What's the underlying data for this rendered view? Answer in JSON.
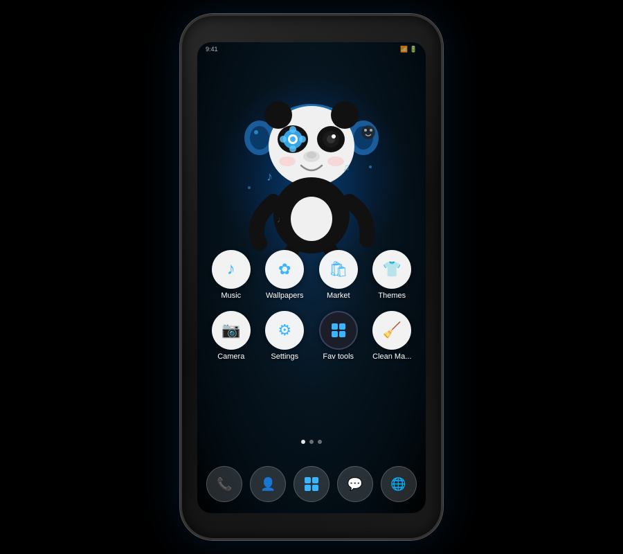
{
  "phone": {
    "status_bar": {
      "time": "9:41",
      "signal": "●●●",
      "battery": "▮▮▮▮"
    },
    "panda_theme": "Blue Neon Panda with Headphones",
    "app_grid": {
      "row1": [
        {
          "id": "music",
          "label": "Music",
          "icon": "♪",
          "dark": false
        },
        {
          "id": "wallpapers",
          "label": "Wallpapers",
          "icon": "✿",
          "dark": false
        },
        {
          "id": "market",
          "label": "Market",
          "icon": "🛍",
          "dark": false
        },
        {
          "id": "themes",
          "label": "Themes",
          "icon": "👕",
          "dark": false
        }
      ],
      "row2": [
        {
          "id": "camera",
          "label": "Camera",
          "icon": "📷",
          "dark": false
        },
        {
          "id": "settings",
          "label": "Settings",
          "icon": "⚙",
          "dark": false
        },
        {
          "id": "favtools",
          "label": "Fav tools",
          "icon": "⬡",
          "dark": true
        },
        {
          "id": "cleanmaster",
          "label": "Clean Ma...",
          "icon": "🧹",
          "dark": false
        }
      ]
    },
    "dots": [
      {
        "active": true
      },
      {
        "active": false
      },
      {
        "active": false
      }
    ],
    "dock": [
      {
        "id": "phone",
        "icon": "📞"
      },
      {
        "id": "contacts",
        "icon": "👤"
      },
      {
        "id": "apps",
        "icon": "⊞"
      },
      {
        "id": "messages",
        "icon": "💬"
      },
      {
        "id": "browser",
        "icon": "🌐"
      }
    ]
  }
}
